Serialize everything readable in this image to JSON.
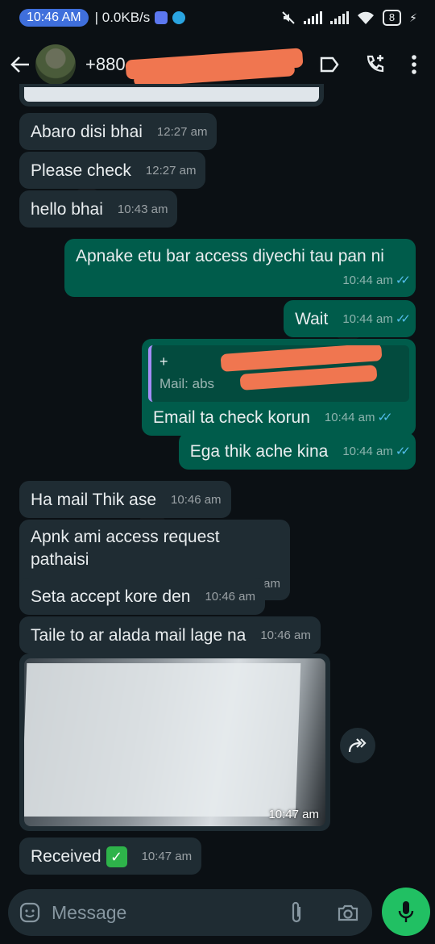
{
  "status_bar": {
    "time": "10:46 AM",
    "net_speed": "| 0.0KB/s",
    "battery": "8"
  },
  "header": {
    "contact_name": "+880"
  },
  "messages": [
    {
      "id": "m1",
      "dir": "in",
      "text": "Abaro disi bhai",
      "time": "12:27 am"
    },
    {
      "id": "m2",
      "dir": "in",
      "text": "Please check",
      "time": "12:27 am"
    },
    {
      "id": "m3",
      "dir": "in",
      "text": "hello bhai",
      "time": "10:43 am"
    },
    {
      "id": "m4",
      "dir": "out",
      "text": "Apnake etu bar access diyechi tau pan ni",
      "time": "10:44 am"
    },
    {
      "id": "m5",
      "dir": "out",
      "text": "Wait",
      "time": "10:44 am"
    },
    {
      "id": "m6",
      "dir": "out",
      "text": "Email ta check korun",
      "time": "10:44 am",
      "quote": {
        "name": "+",
        "text": "Mail: abs"
      }
    },
    {
      "id": "m7",
      "dir": "out",
      "text": "Ega thik ache kina",
      "time": "10:44 am"
    },
    {
      "id": "m8",
      "dir": "in",
      "text": "Ha mail Thik ase",
      "time": "10:46 am"
    },
    {
      "id": "m9",
      "dir": "in",
      "text": "Apnk ami access request pathaisi",
      "time": "10:46 am"
    },
    {
      "id": "m10",
      "dir": "in",
      "text": "Seta accept kore den",
      "time": "10:46 am"
    },
    {
      "id": "m11",
      "dir": "in",
      "text": "Taile to ar alada mail lage na",
      "time": "10:46 am"
    },
    {
      "id": "m12",
      "dir": "in",
      "type": "image",
      "time": "10:47 am"
    },
    {
      "id": "m13",
      "dir": "in",
      "text": "Received",
      "time": "10:47 am",
      "emoji": "✓"
    }
  ],
  "input": {
    "placeholder": "Message"
  },
  "colors": {
    "incoming_bubble": "#1f2c33",
    "outgoing_bubble": "#005c4b",
    "read_tick": "#53bdeb",
    "mic_button": "#21c063"
  }
}
